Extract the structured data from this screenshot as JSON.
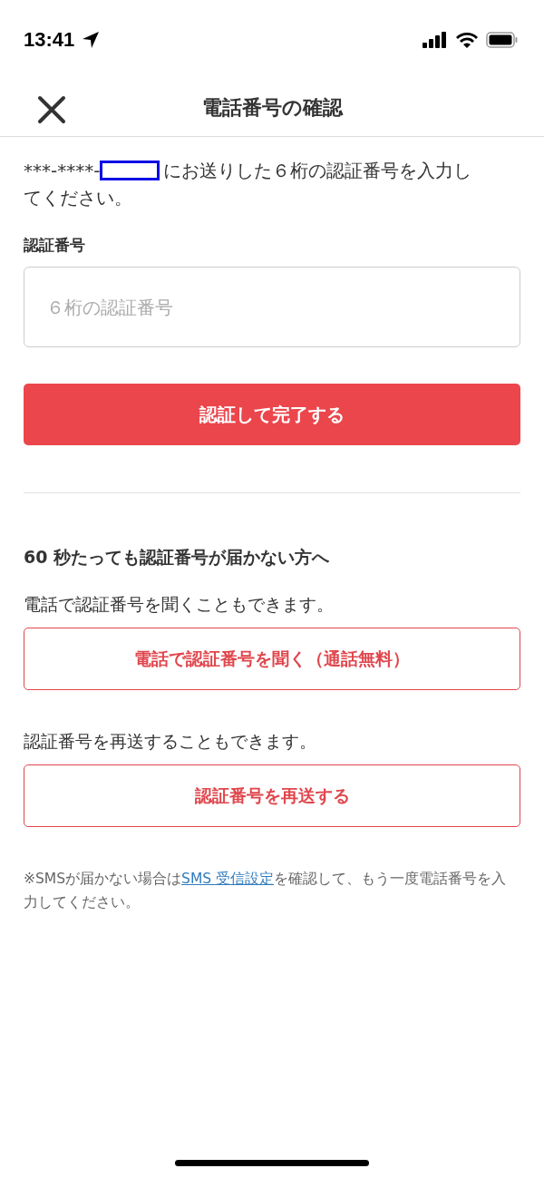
{
  "status_bar": {
    "time": "13:41"
  },
  "header": {
    "title": "電話番号の確認"
  },
  "intro": {
    "prefix": "***-****-",
    "lines": [
      "にお送りした６桁の認証番号を入力し",
      "てください。"
    ]
  },
  "code_field": {
    "label": "認証番号",
    "placeholder": "６桁の認証番号"
  },
  "submit_button": "認証して完了する",
  "help": {
    "heading": "60 秒たっても認証番号が届かない方へ",
    "options": [
      {
        "text": "電話で認証番号を聞くこともできます。",
        "button": "電話で認証番号を聞く（通話無料）"
      },
      {
        "text": "認証番号を再送することもできます。",
        "button": "認証番号を再送する"
      }
    ]
  },
  "note": {
    "before": "※SMSが届かない場合は",
    "link": "SMS 受信設定",
    "after": "を確認して、もう一度電話番号を入力してください。"
  }
}
